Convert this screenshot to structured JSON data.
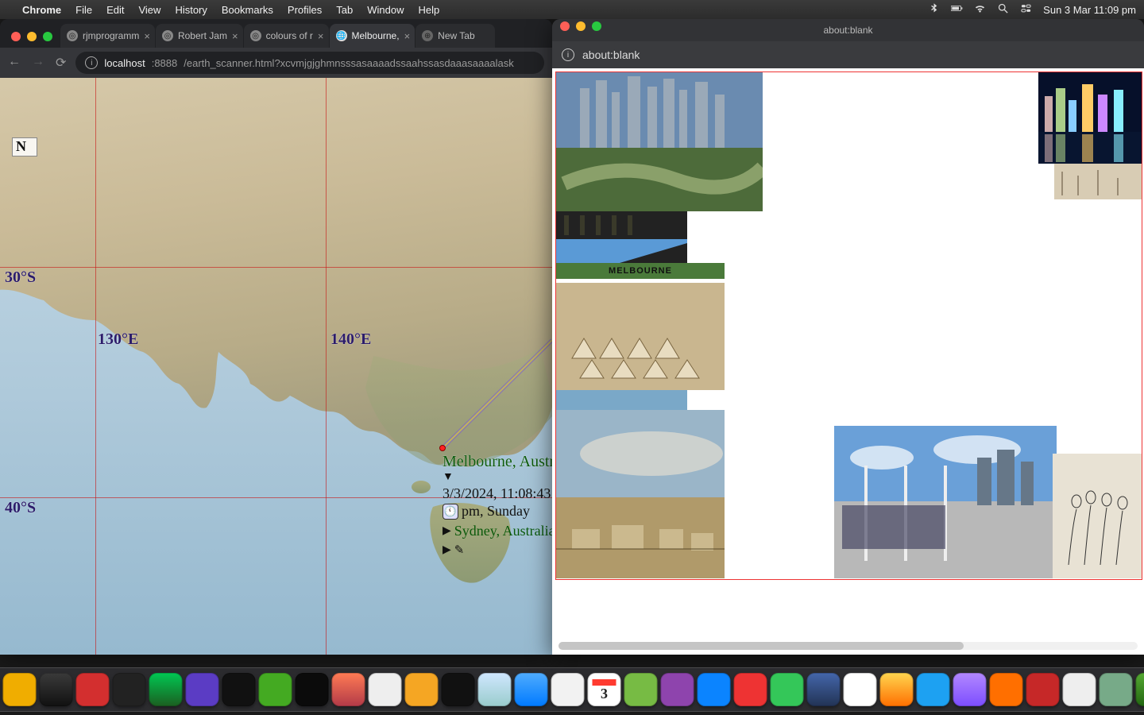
{
  "menubar": {
    "app": "Chrome",
    "items": [
      "File",
      "Edit",
      "View",
      "History",
      "Bookmarks",
      "Profiles",
      "Tab",
      "Window",
      "Help"
    ],
    "clock": "Sun 3 Mar  11:09 pm"
  },
  "chrome": {
    "tabs": [
      {
        "label": "rjmprogramm",
        "active": false
      },
      {
        "label": "Robert Jam",
        "active": false
      },
      {
        "label": "colours of r",
        "active": false
      },
      {
        "label": "Melbourne,",
        "active": true
      },
      {
        "label": "New Tab",
        "active": false
      }
    ],
    "address": {
      "host": "localhost",
      "port": ":8888",
      "path": "/earth_scanner.html?xcvmjgjghmnsssasaaaadssaahssasdaaasaaaalask"
    }
  },
  "map": {
    "n_stamp": "N",
    "lat_labels": {
      "30": "30°S",
      "40": "40°S"
    },
    "lon_labels": {
      "130": "130°E",
      "140": "140°E"
    },
    "place": {
      "name": "Melbourne, Australia",
      "timestamp": "3/3/2024, 11:08:43 PM",
      "daypart": "pm, Sunday",
      "nearby": "Sydney, Australia"
    }
  },
  "popup": {
    "title": "about:blank",
    "address": "about:blank"
  },
  "collage_label": "MELBOURNE"
}
